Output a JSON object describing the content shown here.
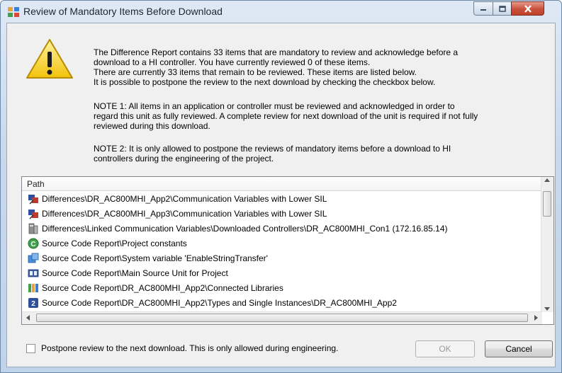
{
  "window": {
    "title": "Review of Mandatory Items Before Download"
  },
  "message": {
    "paragraph1": "The Difference Report contains 33 items that are mandatory to review and acknowledge before a\ndownload to a HI controller. You have currently reviewed 0 of these items.\nThere are currently 33 items that remain to be reviewed. These items are listed below.\nIt is possible to postpone the review to the next download by checking the checkbox below.",
    "note1": "NOTE 1: All items in an application or controller must be reviewed and acknowledged in order to\nregard this unit as fully reviewed. A complete review for next download of the unit is required if not fully\nreviewed during this download.",
    "note2": "NOTE 2: It is only allowed to postpone the reviews of mandatory items before a download to HI\ncontrollers during the engineering of the project."
  },
  "list": {
    "column_header": "Path",
    "rows": [
      {
        "icon": "difference-icon",
        "path": "Differences\\DR_AC800MHI_App2\\Communication Variables with Lower SIL"
      },
      {
        "icon": "difference-icon",
        "path": "Differences\\DR_AC800MHI_App3\\Communication Variables with Lower SIL"
      },
      {
        "icon": "linked-variables-icon",
        "path": "Differences\\Linked Communication Variables\\Downloaded Controllers\\DR_AC800MHI_Con1 (172.16.85.14)"
      },
      {
        "icon": "constants-icon",
        "path": "Source Code Report\\Project constants"
      },
      {
        "icon": "system-variable-icon",
        "path": "Source Code Report\\System variable 'EnableStringTransfer'"
      },
      {
        "icon": "source-unit-icon",
        "path": "Source Code Report\\Main Source Unit for Project"
      },
      {
        "icon": "libraries-icon",
        "path": "Source Code Report\\DR_AC800MHI_App2\\Connected Libraries"
      },
      {
        "icon": "types-icon",
        "path": "Source Code Report\\DR_AC800MHI_App2\\Types and Single Instances\\DR_AC800MHI_App2"
      }
    ]
  },
  "footer": {
    "checkbox_label": "Postpone review to the next download. This is only allowed during engineering.",
    "ok_label": "OK",
    "cancel_label": "Cancel"
  }
}
